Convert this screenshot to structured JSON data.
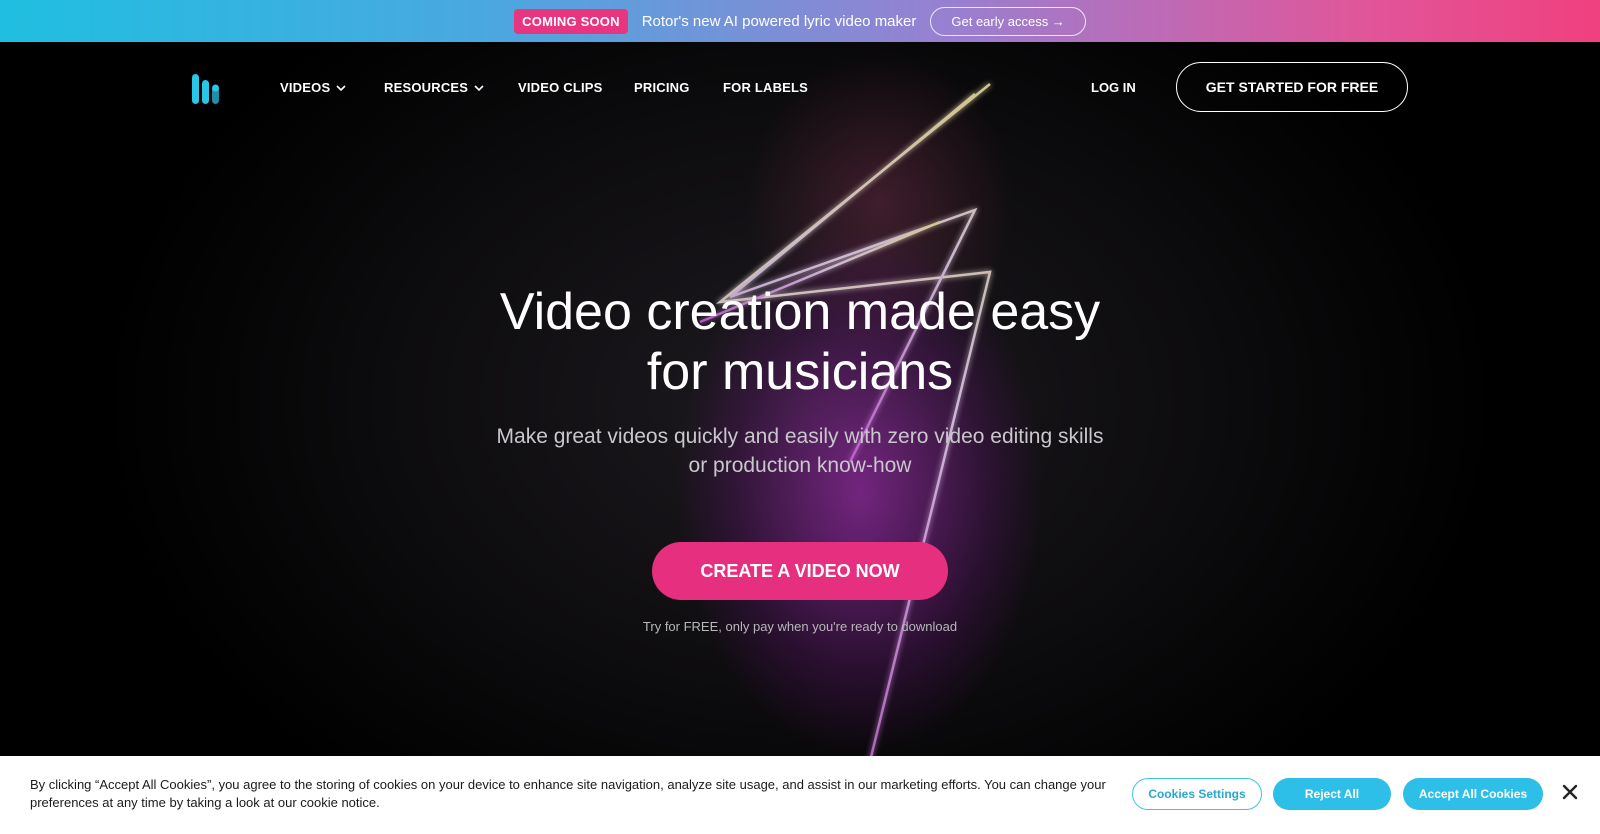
{
  "announcement": {
    "badge": "COMING SOON",
    "text": "Rotor's new AI powered lyric video maker",
    "button": "Get early access →"
  },
  "nav": {
    "logo_icon": "rotor-logo-icon",
    "items": [
      {
        "label": "VIDEOS",
        "has_dropdown": true
      },
      {
        "label": "RESOURCES",
        "has_dropdown": true
      },
      {
        "label": "VIDEO CLIPS",
        "has_dropdown": false
      },
      {
        "label": "PRICING",
        "has_dropdown": false
      },
      {
        "label": "FOR LABELS",
        "has_dropdown": false
      }
    ],
    "login": "LOG IN",
    "get_started": "GET STARTED FOR FREE"
  },
  "hero": {
    "headline_line1": "Video creation made easy",
    "headline_line2": "for musicians",
    "subline_line1": "Make great videos quickly and easily with zero video editing skills",
    "subline_line2": "or production know-how",
    "cta": "CREATE A VIDEO NOW",
    "cta_note": "Try for FREE, only pay when you're ready to download"
  },
  "cookie_banner": {
    "text": "By clicking “Accept All Cookies”, you agree to the storing of cookies on your device to enhance site navigation, analyze site usage, and assist in our marketing efforts. You can change your preferences at any time by taking a look at our cookie notice.",
    "settings_button": "Cookies Settings",
    "reject_button": "Reject All",
    "accept_button": "Accept All Cookies",
    "close_icon": "close-icon"
  },
  "colors": {
    "brand_pink": "#e62f7e",
    "cookie_blue": "#2ebfe8",
    "logo_cyan": "#29c6e6"
  }
}
